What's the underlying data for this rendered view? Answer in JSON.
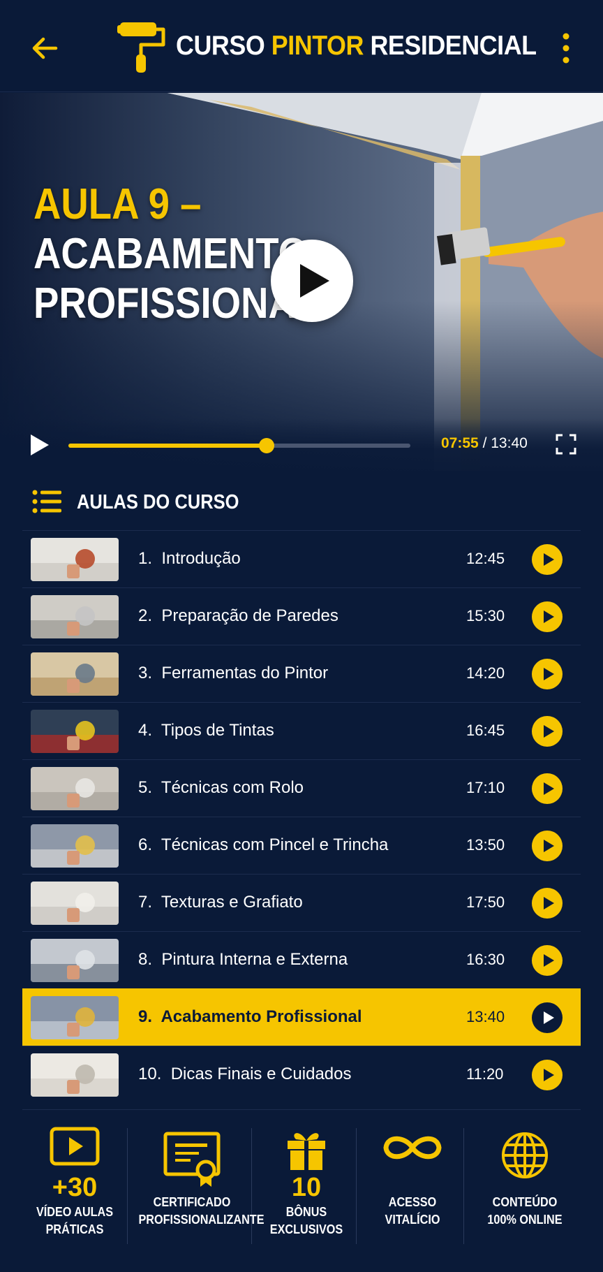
{
  "header": {
    "brand_part1": "CURSO ",
    "brand_part2": "PINTOR",
    "brand_part3": " RESIDENCIAL",
    "accent_color": "#f6c500",
    "background_color": "#0a1a38",
    "icons": [
      "arrow-left-icon",
      "paint-roller-icon",
      "more-vertical-icon"
    ]
  },
  "video": {
    "title_line1": "AULA 9 –",
    "title_line2": "ACABAMENTO",
    "title_line3": "PROFISSIONAL",
    "current_time": "07:55",
    "separator": "/",
    "total_time": "13:40",
    "progress_fraction": 0.58
  },
  "list": {
    "title": "AULAS DO CURSO",
    "lessons": [
      {
        "num": "1.",
        "title": "Introdução",
        "duration": "12:45",
        "active": false
      },
      {
        "num": "2.",
        "title": "Preparação de Paredes",
        "duration": "15:30",
        "active": false
      },
      {
        "num": "3.",
        "title": "Ferramentas do Pintor",
        "duration": "14:20",
        "active": false
      },
      {
        "num": "4.",
        "title": "Tipos de Tintas",
        "duration": "16:45",
        "active": false
      },
      {
        "num": "5.",
        "title": "Técnicas com Rolo",
        "duration": "17:10",
        "active": false
      },
      {
        "num": "6.",
        "title": "Técnicas com Pincel e Trincha",
        "duration": "13:50",
        "active": false
      },
      {
        "num": "7.",
        "title": "Texturas e Grafiato",
        "duration": "17:50",
        "active": false
      },
      {
        "num": "8.",
        "title": "Pintura Interna e Externa",
        "duration": "16:30",
        "active": false
      },
      {
        "num": "9.",
        "title": "Acabamento Profissional",
        "duration": "13:40",
        "active": true
      },
      {
        "num": "10.",
        "title": "Dicas Finais e Cuidados",
        "duration": "11:20",
        "active": false
      }
    ]
  },
  "features": [
    {
      "icon": "video-play-icon",
      "big": "+30",
      "line1": "VÍDEO AULAS",
      "line2": "PRÁTICAS"
    },
    {
      "icon": "certificate-icon",
      "big": "",
      "line1": "CERTIFICADO",
      "line2": "PROFISSIONALIZANTE"
    },
    {
      "icon": "gift-icon",
      "big": "10",
      "line1": "BÔNUS",
      "line2": "EXCLUSIVOS"
    },
    {
      "icon": "infinity-icon",
      "big": "",
      "line1": "ACESSO",
      "line2": "VITALÍCIO"
    },
    {
      "icon": "globe-icon",
      "big": "",
      "line1": "CONTEÚDO",
      "line2": "100% ONLINE"
    }
  ]
}
